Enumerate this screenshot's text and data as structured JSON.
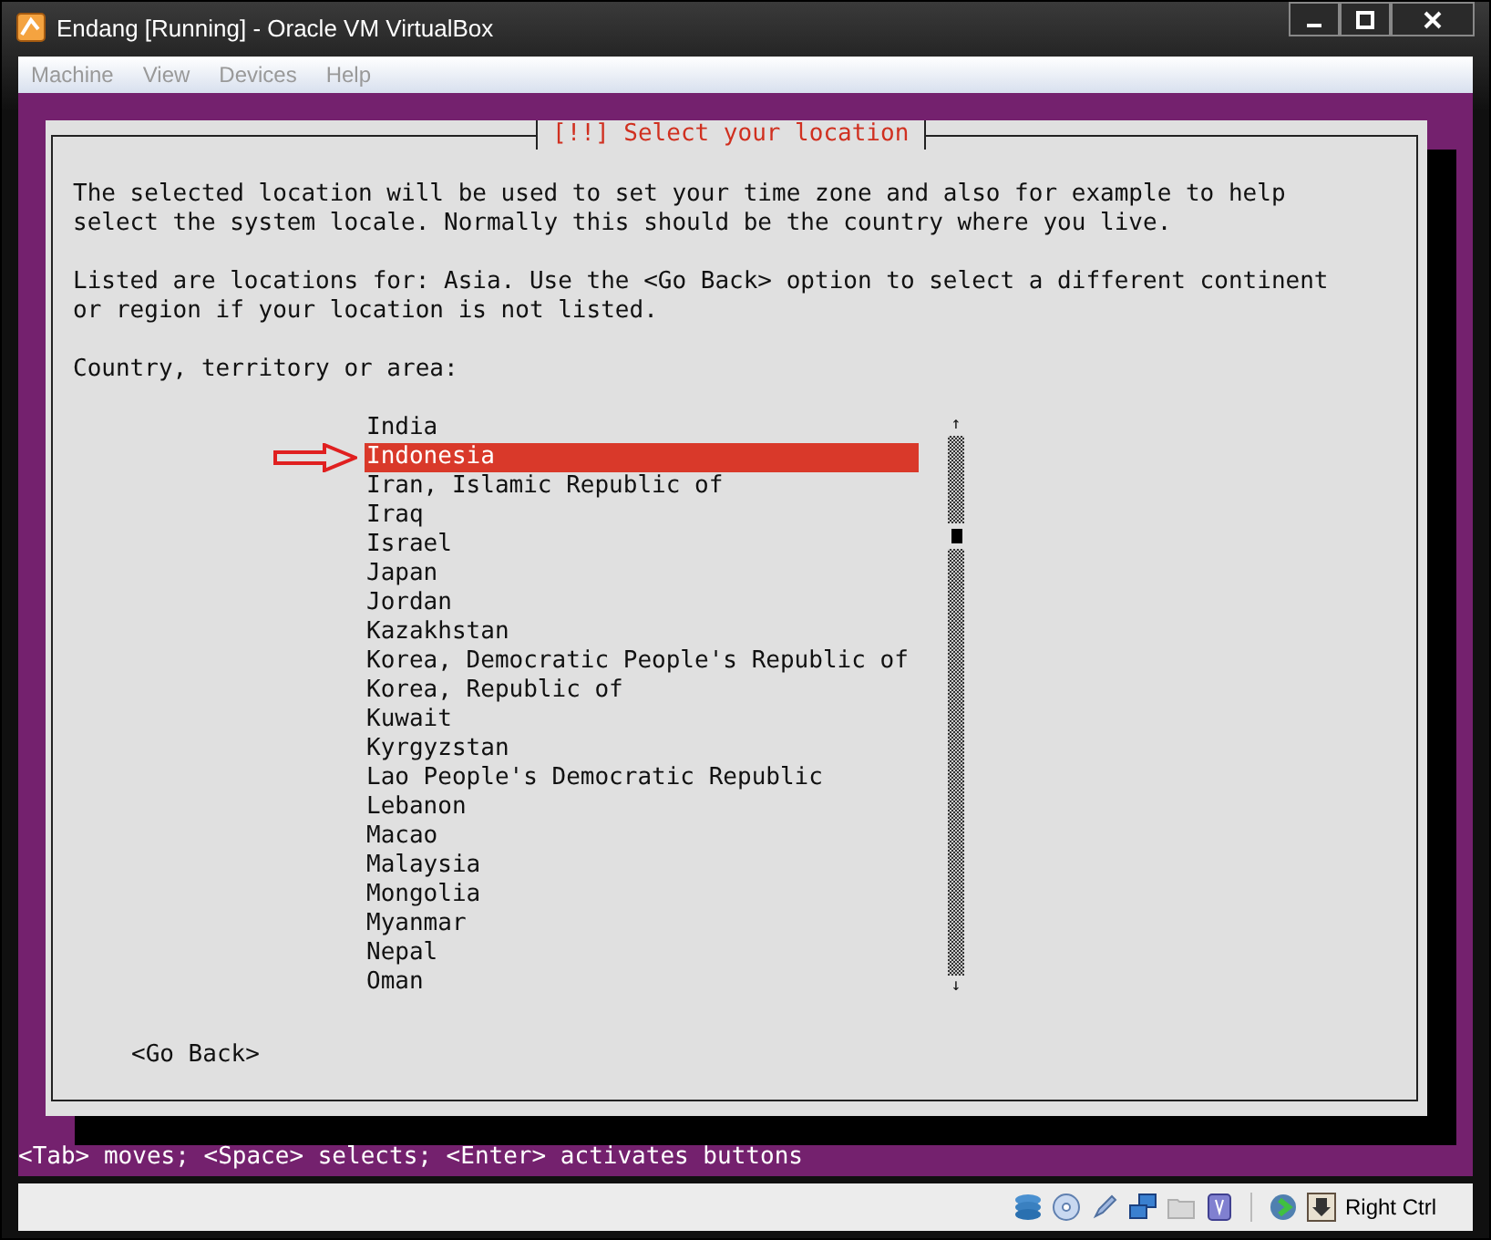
{
  "window": {
    "title": "Endang [Running] - Oracle VM VirtualBox"
  },
  "menu": [
    "Machine",
    "View",
    "Devices",
    "Help"
  ],
  "dialog": {
    "title": "[!!] Select your location",
    "paragraphs": [
      "The selected location will be used to set your time zone and also for example to help select the system locale. Normally this should be the country where you live.",
      "Listed are locations for: Asia. Use the <Go Back> option to select a different continent or region if your location is not listed."
    ],
    "prompt": "Country, territory or area:",
    "countries": [
      {
        "label": "India",
        "selected": false
      },
      {
        "label": "Indonesia",
        "selected": true
      },
      {
        "label": "Iran, Islamic Republic of",
        "selected": false
      },
      {
        "label": "Iraq",
        "selected": false
      },
      {
        "label": "Israel",
        "selected": false
      },
      {
        "label": "Japan",
        "selected": false
      },
      {
        "label": "Jordan",
        "selected": false
      },
      {
        "label": "Kazakhstan",
        "selected": false
      },
      {
        "label": "Korea, Democratic People's Republic of",
        "selected": false
      },
      {
        "label": "Korea, Republic of",
        "selected": false
      },
      {
        "label": "Kuwait",
        "selected": false
      },
      {
        "label": "Kyrgyzstan",
        "selected": false
      },
      {
        "label": "Lao People's Democratic Republic",
        "selected": false
      },
      {
        "label": "Lebanon",
        "selected": false
      },
      {
        "label": "Macao",
        "selected": false
      },
      {
        "label": "Malaysia",
        "selected": false
      },
      {
        "label": "Mongolia",
        "selected": false
      },
      {
        "label": "Myanmar",
        "selected": false
      },
      {
        "label": "Nepal",
        "selected": false
      },
      {
        "label": "Oman",
        "selected": false
      }
    ],
    "scroll_up": "↑",
    "scroll_down": "↓",
    "back_button": "<Go Back>"
  },
  "hint": "<Tab> moves; <Space> selects; <Enter> activates buttons",
  "status_bar": {
    "host_key": "Right Ctrl"
  }
}
